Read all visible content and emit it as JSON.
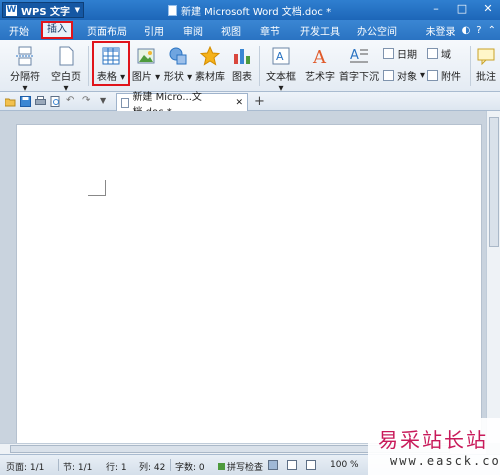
{
  "app": {
    "name": "WPS 文字",
    "doc_title": "新建 Microsoft Word 文档.doc *"
  },
  "menu": {
    "tabs": [
      "开始",
      "插入",
      "页面布局",
      "引用",
      "审阅",
      "视图",
      "章节",
      "开发工具",
      "办公空间"
    ],
    "login": "未登录"
  },
  "ribbon": {
    "page_break": "分隔符",
    "blank_page": "空白页",
    "table": "表格",
    "picture": "图片",
    "shape": "形状",
    "clipart": "素材库",
    "chart": "图表",
    "textbox": "文本框",
    "wordart": "艺术字",
    "dropcap": "首字下沉",
    "date": "日期",
    "object": "对象",
    "field": "域",
    "attachment": "附件",
    "comment": "批注"
  },
  "doc_tab": {
    "label": "新建 Micro...文档.doc *"
  },
  "status": {
    "page": "页面: 1/1",
    "section": "节: 1/1",
    "row": "行: 1",
    "col": "列: 42",
    "words": "字数: 0",
    "spell": "拼写检查",
    "zoom": "100 %"
  },
  "watermark": {
    "line1": "易采站长站",
    "line2": "www.easck.com"
  },
  "colors": {
    "accent": "#2a73c2",
    "highlight": "#e0141b"
  }
}
